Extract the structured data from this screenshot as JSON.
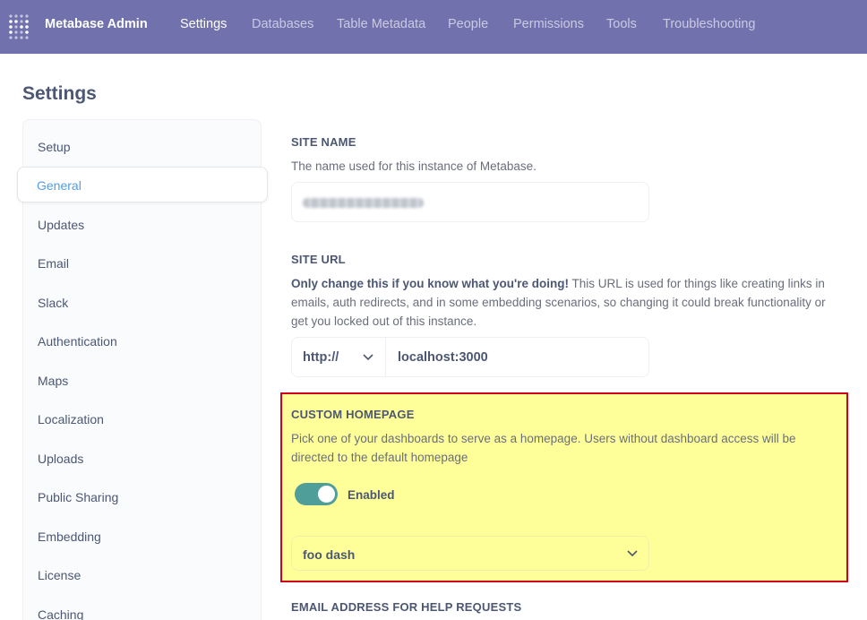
{
  "nav": {
    "brand": "Metabase Admin",
    "links": [
      "Settings",
      "Databases",
      "Table Metadata",
      "People",
      "Permissions",
      "Tools",
      "Troubleshooting"
    ],
    "active": "Settings",
    "logo_icon": "metabase-logo-icon"
  },
  "page": {
    "title": "Settings"
  },
  "sidebar": {
    "items": [
      "Setup",
      "General",
      "Updates",
      "Email",
      "Slack",
      "Authentication",
      "Maps",
      "Localization",
      "Uploads",
      "Public Sharing",
      "Embedding",
      "License",
      "Caching"
    ],
    "active": "General"
  },
  "site_name": {
    "heading": "SITE NAME",
    "description": "The name used for this instance of Metabase."
  },
  "site_url": {
    "heading": "SITE URL",
    "description_bold": "Only change this if you know what you're doing!",
    "description_rest": " This URL is used for things like creating links in emails, auth redirects, and in some embedding scenarios, so changing it could break functionality or get you locked out of this instance.",
    "protocol": "http://",
    "host": "localhost:3000"
  },
  "custom_homepage": {
    "heading": "CUSTOM HOMEPAGE",
    "description": "Pick one of your dashboards to serve as a homepage. Users without dashboard access will be directed to the default homepage",
    "toggle_label": "Enabled",
    "toggle_on": true,
    "selected_dashboard": "foo dash"
  },
  "email_help": {
    "heading": "EMAIL ADDRESS FOR HELP REQUESTS"
  },
  "colors": {
    "nav_bg": "#7172ad",
    "brand_blue": "#509ee3",
    "toggle_on": "#509e9a",
    "highlight_bg": "#ffff99",
    "highlight_border": "#d0021b"
  }
}
